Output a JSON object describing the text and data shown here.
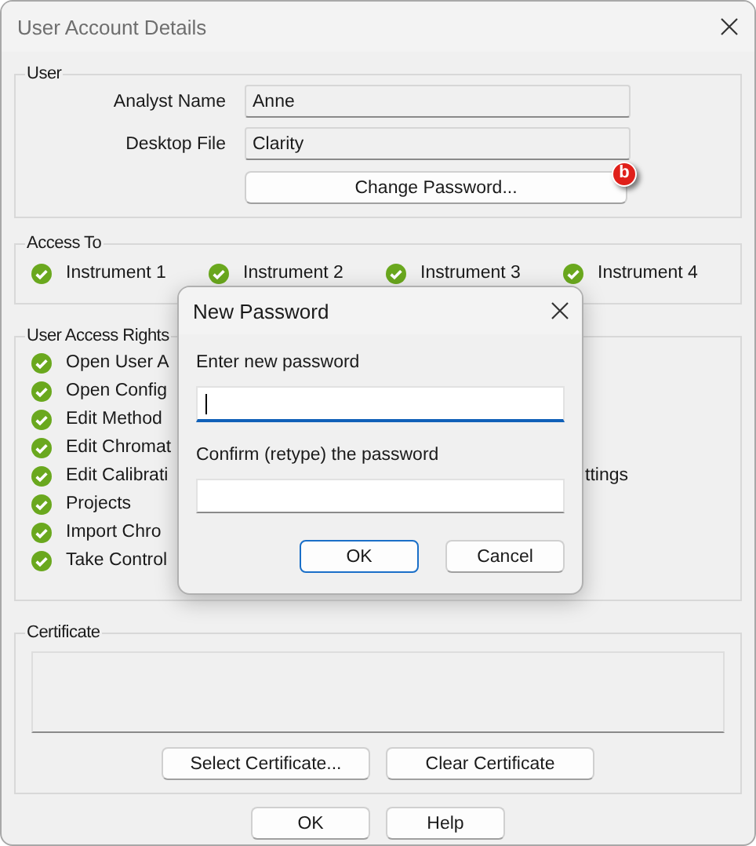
{
  "window": {
    "title": "User Account Details"
  },
  "user": {
    "legend": "User",
    "fields": [
      {
        "label": "Analyst Name",
        "value": "Anne"
      },
      {
        "label": "Desktop File",
        "value": "Clarity"
      }
    ],
    "change_password": "Change Password...",
    "marker": "b"
  },
  "access_to": {
    "legend": "Access To",
    "instruments": [
      {
        "label": "Instrument 1",
        "granted": true
      },
      {
        "label": "Instrument 2",
        "granted": true
      },
      {
        "label": "Instrument 3",
        "granted": true
      },
      {
        "label": "Instrument 4",
        "granted": true
      }
    ]
  },
  "access_rights": {
    "legend": "User Access Rights",
    "rows": [
      {
        "left": {
          "label": "Open User A",
          "granted": true
        }
      },
      {
        "left": {
          "label": "Open Config",
          "granted": true
        }
      },
      {
        "left": {
          "label": "Edit Method",
          "granted": true
        }
      },
      {
        "left": {
          "label": "Edit Chromat",
          "granted": true
        }
      },
      {
        "left": {
          "label": "Edit Calibrati",
          "granted": true
        },
        "right": {
          "label": "ttings"
        }
      },
      {
        "left": {
          "label": "Projects",
          "granted": true
        }
      },
      {
        "left": {
          "label": "Import Chro",
          "granted": true
        }
      },
      {
        "left": {
          "label": "Take Control",
          "granted": true
        }
      }
    ]
  },
  "certificate": {
    "legend": "Certificate",
    "buttons": [
      "Select Certificate...",
      "Clear Certificate"
    ]
  },
  "buttons": [
    "OK",
    "Help"
  ],
  "dialog": {
    "title": "New Password",
    "fields": [
      {
        "label": "Enter new password",
        "focused": true
      },
      {
        "label": "Confirm (retype) the password",
        "focused": false
      }
    ],
    "buttons": [
      {
        "label": "OK",
        "default": true
      },
      {
        "label": "Cancel",
        "default": false
      }
    ]
  }
}
